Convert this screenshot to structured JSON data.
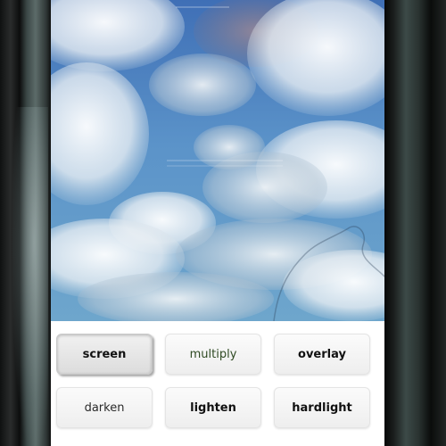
{
  "photo": {
    "description_icon": "cloudy-sky-photo",
    "sky_color": "#4f86be"
  },
  "blend_modes": {
    "screen": "screen",
    "multiply": "multiply",
    "overlay": "overlay",
    "darken": "darken",
    "lighten": "lighten",
    "hardlight": "hardlight"
  },
  "selected_mode": "screen",
  "colors": {
    "multiply_text": "#2f4a23",
    "button_bg": "#f4f4f4"
  }
}
